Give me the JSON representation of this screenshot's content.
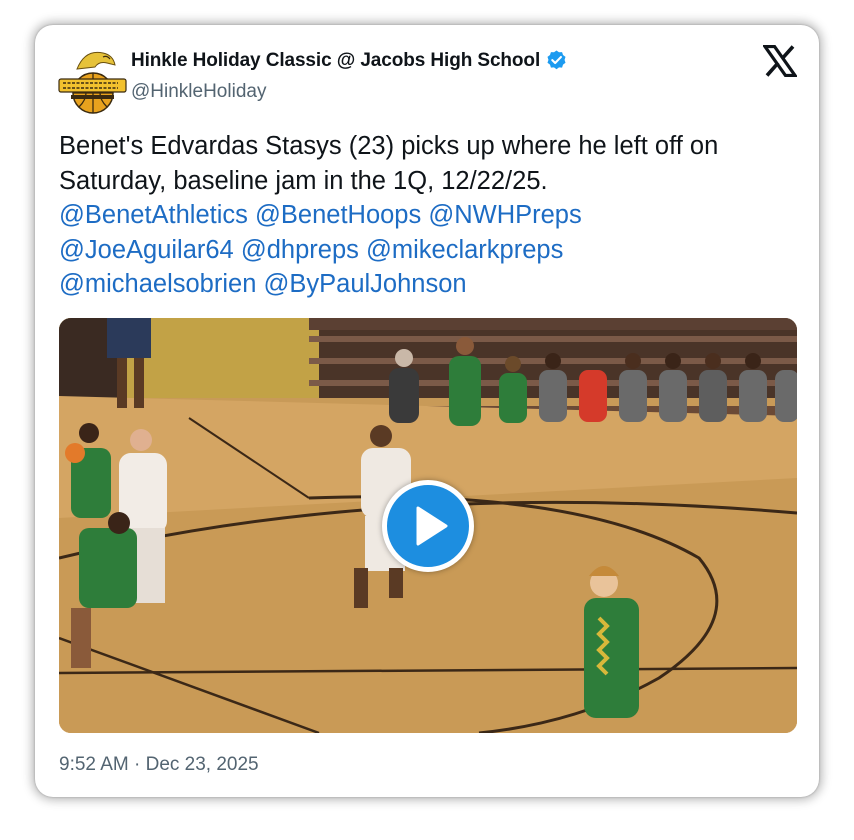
{
  "tweet": {
    "author_name": "Hinkle Holiday Classic @ Jacobs High School",
    "author_handle": "@HinkleHoliday",
    "verified": true,
    "avatar_icon": "hinkle-holiday-logo",
    "body_text": "Benet's Edvardas Stasys (23) picks up where he left off on Saturday, baseline jam in the 1Q, 12/22/25.",
    "mentions": [
      {
        "handle": "@BenetAthletics"
      },
      {
        "handle": "@BenetHoops"
      },
      {
        "handle": "@NWHPreps"
      },
      {
        "handle": "@JoeAguilar64"
      },
      {
        "handle": "@dhpreps"
      },
      {
        "handle": "@mikeclarkpreps"
      },
      {
        "handle": "@michaelsobrien"
      },
      {
        "handle": "@ByPaulJohnson"
      }
    ],
    "timestamp": "9:52 AM · Dec 23, 2025",
    "colors": {
      "link": "#1d6cc4",
      "verified_badge": "#1d9bf0",
      "play_button": "#1d8ee0",
      "secondary_text": "#536471"
    }
  },
  "media": {
    "type": "video",
    "thumbnail": "basketball-game-thumbnail",
    "play_icon": "play-icon",
    "jersey_number": "23"
  },
  "branding": {
    "platform_icon": "x-logo-icon"
  }
}
